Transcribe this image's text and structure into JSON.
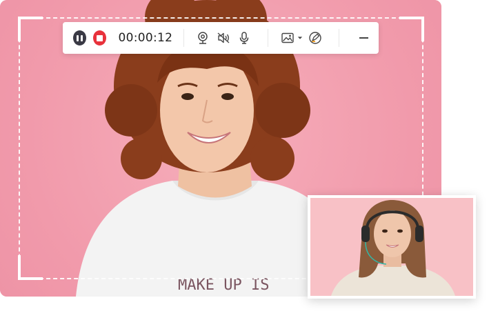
{
  "toolbar": {
    "pause_icon": "pause-icon",
    "stop_icon": "stop-icon",
    "timer": "00:00:12",
    "webcam_icon": "webcam-icon",
    "speaker_icon": "speaker-icon",
    "microphone_icon": "microphone-icon",
    "screenshot_icon": "image-icon",
    "dropdown_icon": "chevron-down-icon",
    "annotate_icon": "pen-icon",
    "minimize_icon": "minimize-icon"
  },
  "shirt_text_line1": "MAKE UP IS",
  "colors": {
    "background_pink": "#f4a3b0",
    "stop_red": "#e8323c",
    "pause_dark": "#3a3a45",
    "webcam_bg": "#f8c1c6"
  }
}
